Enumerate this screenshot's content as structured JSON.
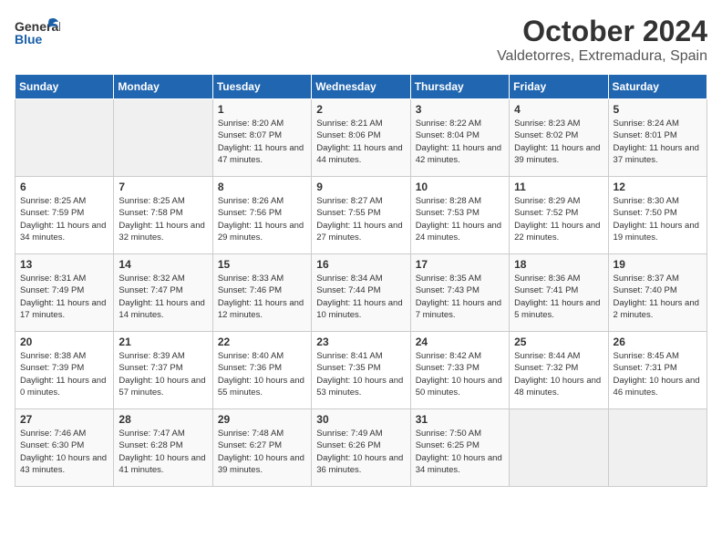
{
  "header": {
    "logo_general": "General",
    "logo_blue": "Blue",
    "month": "October 2024",
    "location": "Valdetorres, Extremadura, Spain"
  },
  "weekdays": [
    "Sunday",
    "Monday",
    "Tuesday",
    "Wednesday",
    "Thursday",
    "Friday",
    "Saturday"
  ],
  "weeks": [
    [
      {
        "day": "",
        "empty": true
      },
      {
        "day": "",
        "empty": true
      },
      {
        "day": "1",
        "sunrise": "Sunrise: 8:20 AM",
        "sunset": "Sunset: 8:07 PM",
        "daylight": "Daylight: 11 hours and 47 minutes."
      },
      {
        "day": "2",
        "sunrise": "Sunrise: 8:21 AM",
        "sunset": "Sunset: 8:06 PM",
        "daylight": "Daylight: 11 hours and 44 minutes."
      },
      {
        "day": "3",
        "sunrise": "Sunrise: 8:22 AM",
        "sunset": "Sunset: 8:04 PM",
        "daylight": "Daylight: 11 hours and 42 minutes."
      },
      {
        "day": "4",
        "sunrise": "Sunrise: 8:23 AM",
        "sunset": "Sunset: 8:02 PM",
        "daylight": "Daylight: 11 hours and 39 minutes."
      },
      {
        "day": "5",
        "sunrise": "Sunrise: 8:24 AM",
        "sunset": "Sunset: 8:01 PM",
        "daylight": "Daylight: 11 hours and 37 minutes."
      }
    ],
    [
      {
        "day": "6",
        "sunrise": "Sunrise: 8:25 AM",
        "sunset": "Sunset: 7:59 PM",
        "daylight": "Daylight: 11 hours and 34 minutes."
      },
      {
        "day": "7",
        "sunrise": "Sunrise: 8:25 AM",
        "sunset": "Sunset: 7:58 PM",
        "daylight": "Daylight: 11 hours and 32 minutes."
      },
      {
        "day": "8",
        "sunrise": "Sunrise: 8:26 AM",
        "sunset": "Sunset: 7:56 PM",
        "daylight": "Daylight: 11 hours and 29 minutes."
      },
      {
        "day": "9",
        "sunrise": "Sunrise: 8:27 AM",
        "sunset": "Sunset: 7:55 PM",
        "daylight": "Daylight: 11 hours and 27 minutes."
      },
      {
        "day": "10",
        "sunrise": "Sunrise: 8:28 AM",
        "sunset": "Sunset: 7:53 PM",
        "daylight": "Daylight: 11 hours and 24 minutes."
      },
      {
        "day": "11",
        "sunrise": "Sunrise: 8:29 AM",
        "sunset": "Sunset: 7:52 PM",
        "daylight": "Daylight: 11 hours and 22 minutes."
      },
      {
        "day": "12",
        "sunrise": "Sunrise: 8:30 AM",
        "sunset": "Sunset: 7:50 PM",
        "daylight": "Daylight: 11 hours and 19 minutes."
      }
    ],
    [
      {
        "day": "13",
        "sunrise": "Sunrise: 8:31 AM",
        "sunset": "Sunset: 7:49 PM",
        "daylight": "Daylight: 11 hours and 17 minutes."
      },
      {
        "day": "14",
        "sunrise": "Sunrise: 8:32 AM",
        "sunset": "Sunset: 7:47 PM",
        "daylight": "Daylight: 11 hours and 14 minutes."
      },
      {
        "day": "15",
        "sunrise": "Sunrise: 8:33 AM",
        "sunset": "Sunset: 7:46 PM",
        "daylight": "Daylight: 11 hours and 12 minutes."
      },
      {
        "day": "16",
        "sunrise": "Sunrise: 8:34 AM",
        "sunset": "Sunset: 7:44 PM",
        "daylight": "Daylight: 11 hours and 10 minutes."
      },
      {
        "day": "17",
        "sunrise": "Sunrise: 8:35 AM",
        "sunset": "Sunset: 7:43 PM",
        "daylight": "Daylight: 11 hours and 7 minutes."
      },
      {
        "day": "18",
        "sunrise": "Sunrise: 8:36 AM",
        "sunset": "Sunset: 7:41 PM",
        "daylight": "Daylight: 11 hours and 5 minutes."
      },
      {
        "day": "19",
        "sunrise": "Sunrise: 8:37 AM",
        "sunset": "Sunset: 7:40 PM",
        "daylight": "Daylight: 11 hours and 2 minutes."
      }
    ],
    [
      {
        "day": "20",
        "sunrise": "Sunrise: 8:38 AM",
        "sunset": "Sunset: 7:39 PM",
        "daylight": "Daylight: 11 hours and 0 minutes."
      },
      {
        "day": "21",
        "sunrise": "Sunrise: 8:39 AM",
        "sunset": "Sunset: 7:37 PM",
        "daylight": "Daylight: 10 hours and 57 minutes."
      },
      {
        "day": "22",
        "sunrise": "Sunrise: 8:40 AM",
        "sunset": "Sunset: 7:36 PM",
        "daylight": "Daylight: 10 hours and 55 minutes."
      },
      {
        "day": "23",
        "sunrise": "Sunrise: 8:41 AM",
        "sunset": "Sunset: 7:35 PM",
        "daylight": "Daylight: 10 hours and 53 minutes."
      },
      {
        "day": "24",
        "sunrise": "Sunrise: 8:42 AM",
        "sunset": "Sunset: 7:33 PM",
        "daylight": "Daylight: 10 hours and 50 minutes."
      },
      {
        "day": "25",
        "sunrise": "Sunrise: 8:44 AM",
        "sunset": "Sunset: 7:32 PM",
        "daylight": "Daylight: 10 hours and 48 minutes."
      },
      {
        "day": "26",
        "sunrise": "Sunrise: 8:45 AM",
        "sunset": "Sunset: 7:31 PM",
        "daylight": "Daylight: 10 hours and 46 minutes."
      }
    ],
    [
      {
        "day": "27",
        "sunrise": "Sunrise: 7:46 AM",
        "sunset": "Sunset: 6:30 PM",
        "daylight": "Daylight: 10 hours and 43 minutes."
      },
      {
        "day": "28",
        "sunrise": "Sunrise: 7:47 AM",
        "sunset": "Sunset: 6:28 PM",
        "daylight": "Daylight: 10 hours and 41 minutes."
      },
      {
        "day": "29",
        "sunrise": "Sunrise: 7:48 AM",
        "sunset": "Sunset: 6:27 PM",
        "daylight": "Daylight: 10 hours and 39 minutes."
      },
      {
        "day": "30",
        "sunrise": "Sunrise: 7:49 AM",
        "sunset": "Sunset: 6:26 PM",
        "daylight": "Daylight: 10 hours and 36 minutes."
      },
      {
        "day": "31",
        "sunrise": "Sunrise: 7:50 AM",
        "sunset": "Sunset: 6:25 PM",
        "daylight": "Daylight: 10 hours and 34 minutes."
      },
      {
        "day": "",
        "empty": true
      },
      {
        "day": "",
        "empty": true
      }
    ]
  ]
}
